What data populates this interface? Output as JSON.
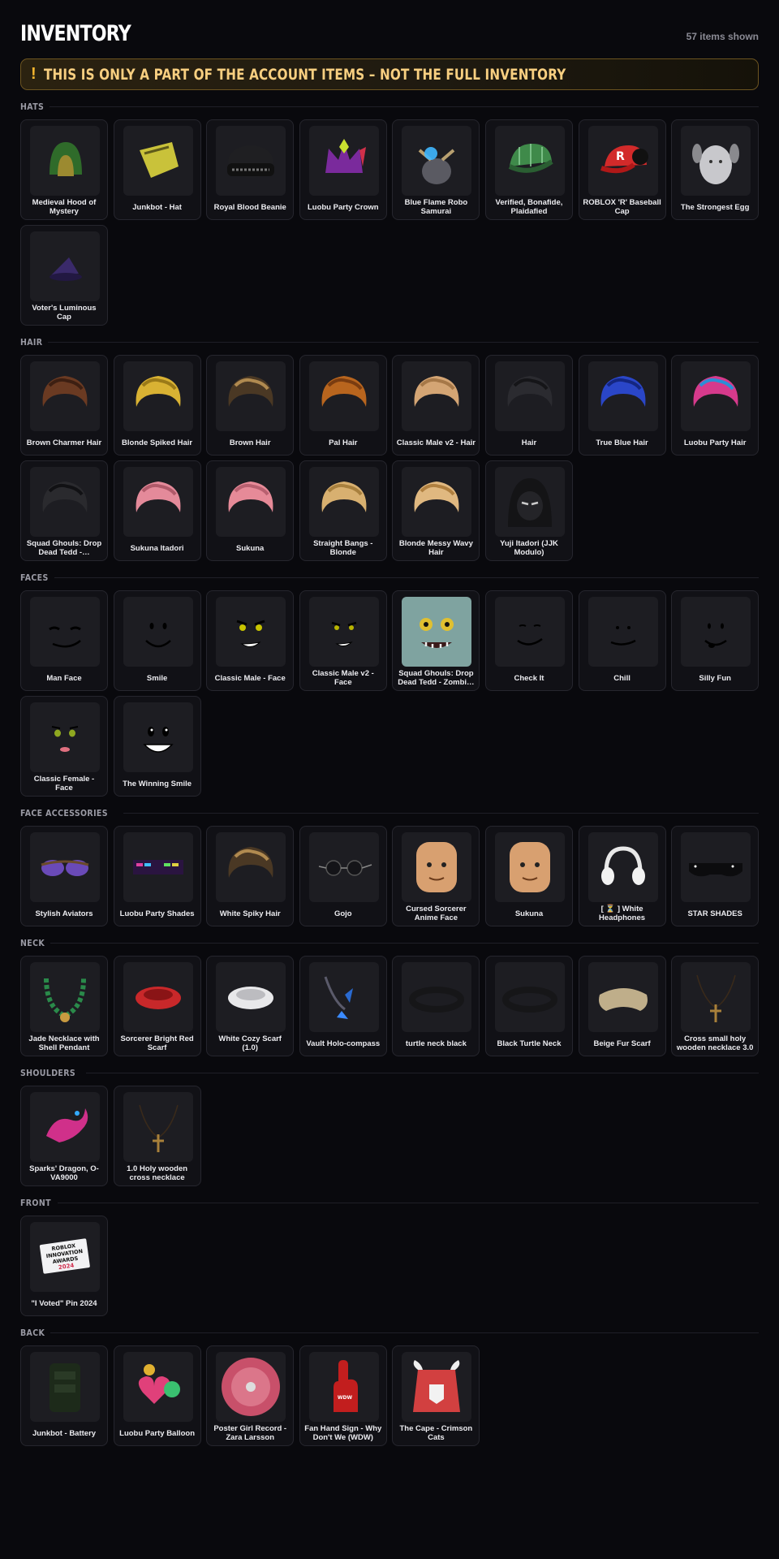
{
  "page": {
    "title": "INVENTORY",
    "count_text": "57 items shown",
    "notice_icon": "!",
    "notice": "THIS IS ONLY A PART OF THE ACCOUNT ITEMS – NOT THE FULL INVENTORY"
  },
  "sections": [
    {
      "name": "HATS",
      "items": [
        {
          "label": "Medieval Hood of Mystery",
          "icon": "hood-icon"
        },
        {
          "label": "Junkbot - Hat",
          "icon": "junkbot-hat-icon"
        },
        {
          "label": "Royal Blood Beanie",
          "icon": "beanie-icon"
        },
        {
          "label": "Luobu Party Crown",
          "icon": "crown-icon"
        },
        {
          "label": "Blue Flame Robo Samurai",
          "icon": "samurai-helmet-icon"
        },
        {
          "label": "Verified, Bonafide, Plaidafied",
          "icon": "plaid-cap-icon"
        },
        {
          "label": "ROBLOX 'R' Baseball Cap",
          "icon": "baseball-cap-icon"
        },
        {
          "label": "The Strongest Egg",
          "icon": "egg-icon"
        },
        {
          "label": "Voter's Luminous Cap",
          "icon": "wizard-cap-icon"
        }
      ]
    },
    {
      "name": "HAIR",
      "items": [
        {
          "label": "Brown Charmer Hair",
          "icon": "hair-icon"
        },
        {
          "label": "Blonde Spiked Hair",
          "icon": "hair-icon"
        },
        {
          "label": "Brown Hair",
          "icon": "hair-icon"
        },
        {
          "label": "Pal Hair",
          "icon": "hair-icon"
        },
        {
          "label": "Classic Male v2 - Hair",
          "icon": "hair-icon"
        },
        {
          "label": "Hair",
          "icon": "hair-icon"
        },
        {
          "label": "True Blue Hair",
          "icon": "hair-icon"
        },
        {
          "label": "Luobu Party Hair",
          "icon": "hair-icon"
        },
        {
          "label": "Squad Ghouls: Drop Dead Tedd -…",
          "icon": "hair-icon"
        },
        {
          "label": "Sukuna Itadori",
          "icon": "hair-icon"
        },
        {
          "label": "Sukuna",
          "icon": "hair-icon"
        },
        {
          "label": "Straight Bangs - Blonde",
          "icon": "hair-icon"
        },
        {
          "label": "Blonde Messy Wavy Hair",
          "icon": "hair-icon"
        },
        {
          "label": "Yuji Itadori (JJK Modulo)",
          "icon": "hood-mask-icon"
        }
      ]
    },
    {
      "name": "FACES",
      "items": [
        {
          "label": "Man Face",
          "icon": "face-icon"
        },
        {
          "label": "Smile",
          "icon": "face-icon"
        },
        {
          "label": "Classic Male - Face",
          "icon": "face-icon"
        },
        {
          "label": "Classic Male v2 - Face",
          "icon": "face-icon"
        },
        {
          "label": "Squad Ghouls: Drop Dead Tedd - Zombi…",
          "icon": "zombie-face-icon"
        },
        {
          "label": "Check It",
          "icon": "face-icon"
        },
        {
          "label": "Chill",
          "icon": "face-icon"
        },
        {
          "label": "Silly Fun",
          "icon": "face-icon"
        },
        {
          "label": "Classic Female - Face",
          "icon": "face-icon"
        },
        {
          "label": "The Winning Smile",
          "icon": "face-icon"
        }
      ]
    },
    {
      "name": "FACE ACCESSORIES",
      "items": [
        {
          "label": "Stylish Aviators",
          "icon": "sunglasses-icon"
        },
        {
          "label": "Luobu Party Shades",
          "icon": "pixel-shades-icon"
        },
        {
          "label": "White Spiky Hair",
          "icon": "hair-icon"
        },
        {
          "label": "Gojo",
          "icon": "round-glasses-icon"
        },
        {
          "label": "Cursed Sorcerer Anime Face",
          "icon": "head-icon"
        },
        {
          "label": "Sukuna",
          "icon": "head-icon"
        },
        {
          "label": "[ ⏳ ] White Headphones",
          "icon": "headphones-icon"
        },
        {
          "label": "STAR SHADES",
          "icon": "shades-icon"
        }
      ]
    },
    {
      "name": "NECK",
      "items": [
        {
          "label": "Jade Necklace with Shell Pendant",
          "icon": "necklace-icon"
        },
        {
          "label": "Sorcerer Bright Red Scarf",
          "icon": "scarf-icon"
        },
        {
          "label": "White Cozy Scarf (1.0)",
          "icon": "scarf-icon"
        },
        {
          "label": "Vault Holo-compass",
          "icon": "compass-icon"
        },
        {
          "label": "turtle neck black",
          "icon": "collar-icon"
        },
        {
          "label": "Black Turtle Neck",
          "icon": "collar-icon"
        },
        {
          "label": "Beige Fur Scarf",
          "icon": "fur-scarf-icon"
        },
        {
          "label": "Cross small holy wooden necklace 3.0",
          "icon": "cross-necklace-icon"
        }
      ]
    },
    {
      "name": "SHOULDERS",
      "items": [
        {
          "label": "Sparks' Dragon, O-VA9000",
          "icon": "dragon-icon"
        },
        {
          "label": "1.0 Holy wooden cross necklace",
          "icon": "cross-necklace-icon"
        }
      ]
    },
    {
      "name": "FRONT",
      "items": [
        {
          "label": "\"I Voted\" Pin 2024",
          "icon": "pin-icon",
          "pin_text": [
            "ROBLOX",
            "INNOVATION",
            "AWARDS",
            "2024"
          ]
        }
      ]
    },
    {
      "name": "BACK",
      "items": [
        {
          "label": "Junkbot - Battery",
          "icon": "battery-icon"
        },
        {
          "label": "Luobu Party Balloon",
          "icon": "balloon-icon"
        },
        {
          "label": "Poster Girl Record - Zara Larsson",
          "icon": "record-icon"
        },
        {
          "label": "Fan Hand Sign - Why Don't We (WDW)",
          "icon": "foam-hand-icon"
        },
        {
          "label": "The Cape - Crimson Cats",
          "icon": "cape-icon"
        }
      ]
    }
  ],
  "colors": {
    "background": "#09090d",
    "card": "#111116",
    "notice_text": "#f8cf80",
    "notice_border": "#6c5420",
    "accent": "#f2b42e"
  }
}
